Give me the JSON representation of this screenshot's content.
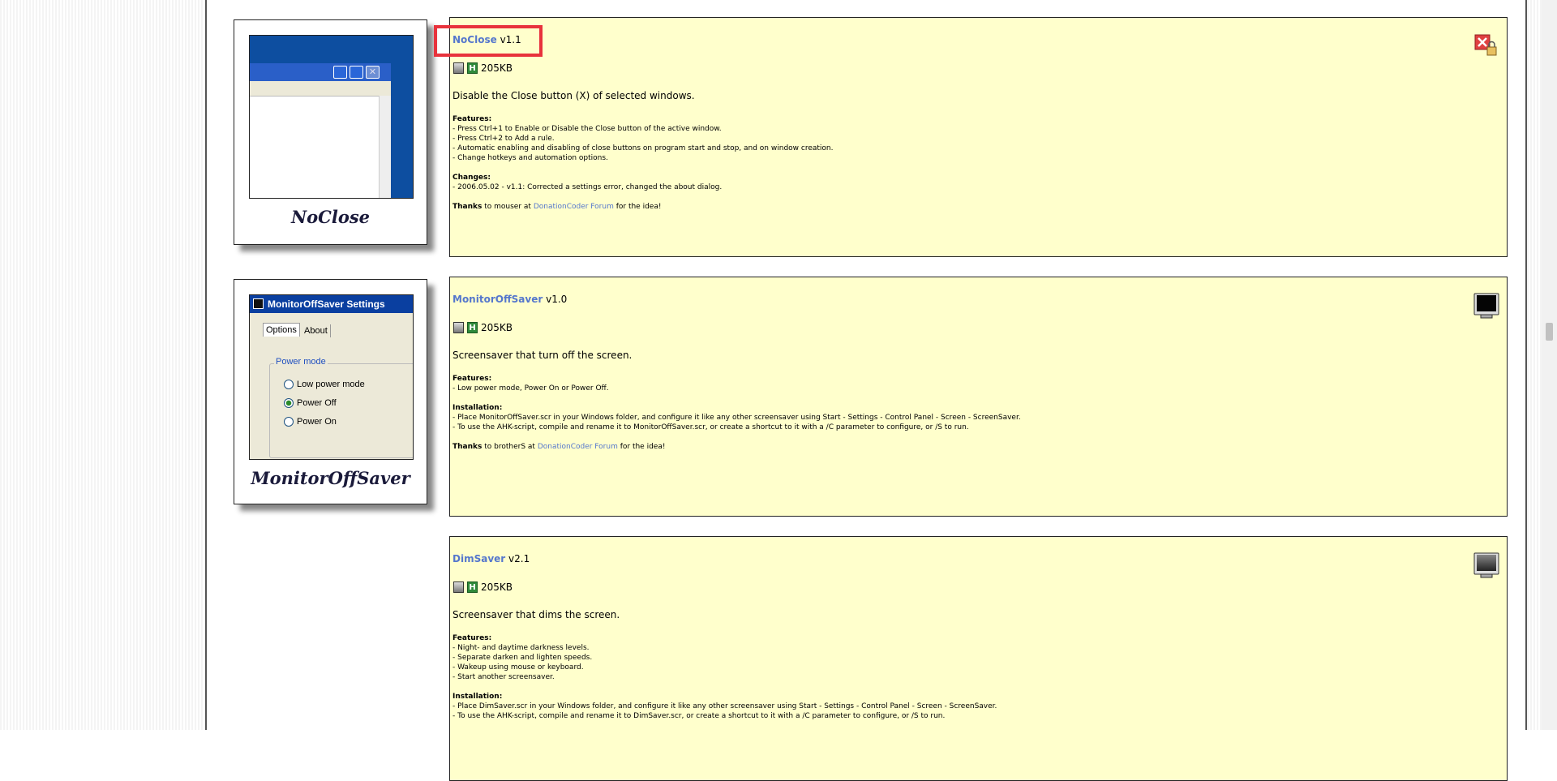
{
  "items": [
    {
      "thumb_title": "NoClose",
      "name": "NoClose",
      "version": "v1.1",
      "size": "205KB",
      "description": "Disable the Close button (X) of selected windows.",
      "features_heading": "Features:",
      "features": [
        "- Press Ctrl+1 to Enable or Disable the Close button of the active window.",
        "- Press Ctrl+2 to Add a rule.",
        "- Automatic enabling and disabling of close buttons on program start and stop, and on window creation.",
        "- Change hotkeys and automation options."
      ],
      "changes_heading": "Changes:",
      "changes": [
        "- 2006.05.02 - v1.1: Corrected a settings error, changed the about dialog."
      ],
      "thanks_label": "Thanks",
      "thanks_pre": " to mouser at ",
      "thanks_link": "DonationCoder Forum",
      "thanks_post": " for the idea!",
      "icon": "close-lock-icon"
    },
    {
      "thumb_title": "MonitorOffSaver",
      "name": "MonitorOffSaver",
      "version": "v1.0",
      "size": "205KB",
      "description": "Screensaver that turn off the screen.",
      "features_heading": "Features:",
      "features": [
        "- Low power mode, Power On or Power Off."
      ],
      "installation_heading": "Installation:",
      "installation": [
        "- Place MonitorOffSaver.scr in your Windows folder, and configure it like any other screensaver using Start - Settings - Control Panel - Screen - ScreenSaver.",
        "- To use the AHK-script, compile and rename it to MonitorOffSaver.scr, or create a shortcut to it with a /C parameter to configure, or /S to run."
      ],
      "thanks_label": "Thanks",
      "thanks_pre": " to brotherS at ",
      "thanks_link": "DonationCoder Forum",
      "thanks_post": " for the idea!",
      "icon": "monitor-black-icon",
      "settings_window": {
        "title": "MonitorOffSaver Settings",
        "tabs": [
          "Options",
          "About"
        ],
        "group": "Power mode",
        "options": [
          "Low power mode",
          "Power Off",
          "Power On"
        ],
        "selected": "Power Off"
      }
    },
    {
      "name": "DimSaver",
      "version": "v2.1",
      "size": "205KB",
      "description": "Screensaver that dims the screen.",
      "features_heading": "Features:",
      "features": [
        "- Night- and daytime darkness levels.",
        "- Separate darken and lighten speeds.",
        "- Wakeup using mouse or keyboard.",
        "- Start another screensaver."
      ],
      "installation_heading": "Installation:",
      "installation": [
        "- Place DimSaver.scr in your Windows folder, and configure it like any other screensaver using Start - Settings - Control Panel - Screen - ScreenSaver.",
        "- To use the AHK-script, compile and rename it to DimSaver.scr, or create a shortcut to it with a /C parameter to configure, or /S to run."
      ],
      "icon": "monitor-gray-icon"
    }
  ]
}
